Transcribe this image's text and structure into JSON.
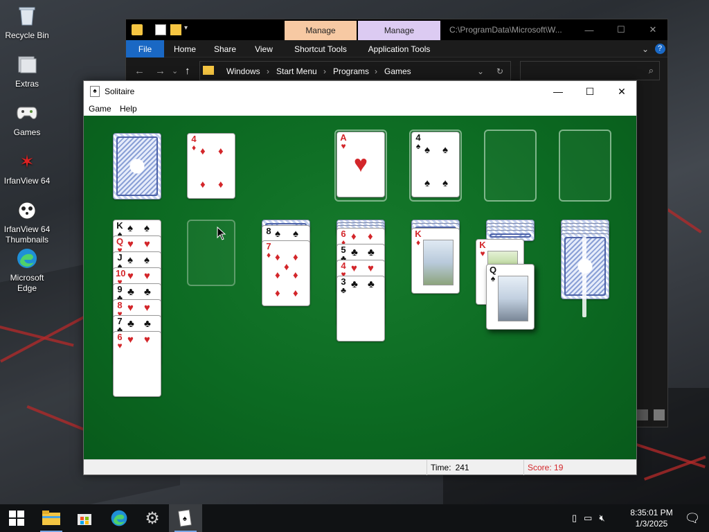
{
  "desktop": {
    "icons": [
      {
        "label": "Recycle Bin",
        "icon": "recycle-bin-icon"
      },
      {
        "label": "Extras",
        "icon": "folder-icon"
      },
      {
        "label": "Games",
        "icon": "gamepad-icon"
      },
      {
        "label": "IrfanView 64",
        "icon": "irfanview-icon"
      },
      {
        "label": "IrfanView 64 Thumbnails",
        "icon": "irfanview-thumbnails-icon"
      },
      {
        "label": "Microsoft Edge",
        "icon": "edge-icon"
      }
    ]
  },
  "explorer": {
    "manage_tabs": [
      "Manage",
      "Manage"
    ],
    "title_path": "C:\\ProgramData\\Microsoft\\W...",
    "ribbon_tabs": [
      "File",
      "Home",
      "Share",
      "View",
      "Shortcut Tools",
      "Application Tools"
    ],
    "breadcrumbs": [
      "Windows",
      "Start Menu",
      "Programs",
      "Games"
    ],
    "search_placeholder": "",
    "colors": {
      "manage1": "#f7c9a3",
      "manage2": "#dccbf2",
      "file_tab": "#1a68c4"
    }
  },
  "solitaire": {
    "title": "Solitaire",
    "menu": [
      "Game",
      "Help"
    ],
    "status": {
      "time_label": "Time:",
      "time_value": "241",
      "score": "Score: 19"
    },
    "colors": {
      "felt": "#0c6a22",
      "score_text": "#d3262a"
    },
    "stock": {
      "state": "face-down"
    },
    "waste": {
      "rank": "4",
      "suit": "♦"
    },
    "foundations": [
      {
        "rank": "A",
        "suit": "♥"
      },
      {
        "rank": "4",
        "suit": "♠"
      },
      {
        "rank": "",
        "suit": ""
      },
      {
        "rank": "",
        "suit": ""
      }
    ],
    "tableau": [
      {
        "name": "pile-1",
        "cards": [
          {
            "rank": "K",
            "suit": "♠"
          },
          {
            "rank": "Q",
            "suit": "♥"
          },
          {
            "rank": "J",
            "suit": "♠"
          },
          {
            "rank": "10",
            "suit": "♥"
          },
          {
            "rank": "9",
            "suit": "♣"
          },
          {
            "rank": "8",
            "suit": "♥"
          },
          {
            "rank": "7",
            "suit": "♣"
          },
          {
            "rank": "6",
            "suit": "♥"
          }
        ]
      },
      {
        "name": "pile-2",
        "cards": []
      },
      {
        "name": "pile-3",
        "cards": [
          {
            "rank": "8",
            "suit": "♠"
          },
          {
            "rank": "7",
            "suit": "♦"
          }
        ]
      },
      {
        "name": "pile-4",
        "cards": [
          {
            "rank": "6",
            "suit": "♦"
          },
          {
            "rank": "5",
            "suit": "♣"
          },
          {
            "rank": "4",
            "suit": "♥"
          },
          {
            "rank": "3",
            "suit": "♣"
          }
        ]
      },
      {
        "name": "pile-5",
        "cards": [
          {
            "rank": "K",
            "suit": "♦"
          }
        ]
      },
      {
        "name": "pile-6",
        "cards": [
          {
            "rank": "K",
            "suit": "♥"
          }
        ]
      },
      {
        "name": "pile-7",
        "cards": []
      }
    ],
    "dragged_card": {
      "rank": "Q",
      "suit": "♠"
    }
  },
  "taskbar": {
    "buttons": [
      "start-icon",
      "file-explorer-icon",
      "store-icon",
      "edge-icon",
      "settings-gear-icon",
      "solitaire-icon"
    ],
    "tray_icons": [
      "usb-icon",
      "network-icon",
      "volume-muted-icon"
    ],
    "time": "8:35:01 PM",
    "date": "1/3/2025"
  }
}
